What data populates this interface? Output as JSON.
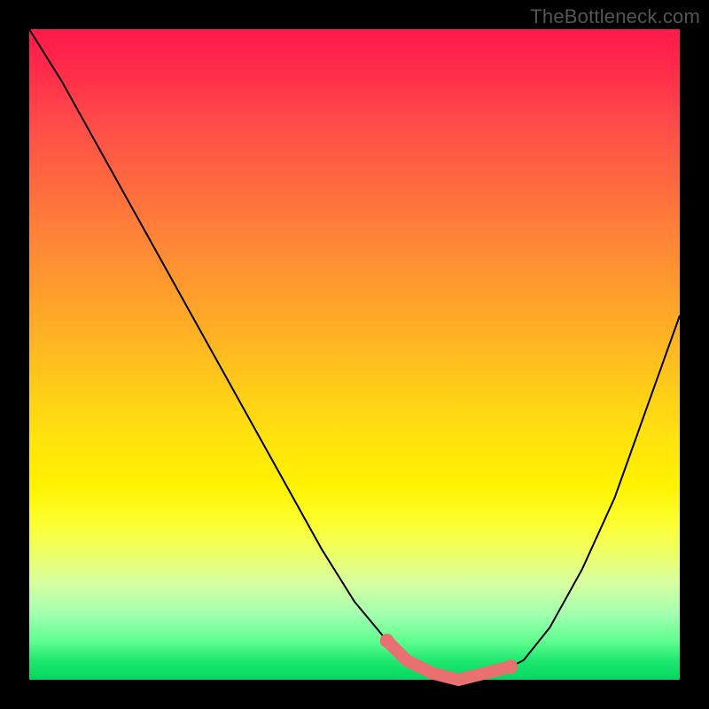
{
  "watermark": "TheBottleneck.com",
  "chart_data": {
    "type": "line",
    "title": "",
    "xlabel": "",
    "ylabel": "",
    "xlim": [
      0,
      100
    ],
    "ylim": [
      0,
      100
    ],
    "grid": false,
    "legend": false,
    "background_gradient": {
      "direction": "vertical",
      "stops": [
        {
          "pos": 0,
          "color": "#ff1a4a",
          "meaning": "high"
        },
        {
          "pos": 50,
          "color": "#ffd000",
          "meaning": "mid"
        },
        {
          "pos": 100,
          "color": "#00d860",
          "meaning": "low"
        }
      ]
    },
    "series": [
      {
        "name": "curve",
        "x": [
          0,
          5,
          10,
          15,
          20,
          25,
          30,
          35,
          40,
          45,
          50,
          55,
          60,
          62,
          65,
          68,
          72,
          76,
          80,
          85,
          90,
          95,
          100
        ],
        "y": [
          100,
          92,
          83,
          74,
          65,
          56,
          47,
          38,
          29,
          20,
          12,
          6,
          2,
          1,
          0,
          0,
          1,
          3,
          8,
          17,
          28,
          42,
          56
        ]
      }
    ],
    "highlight": {
      "name": "optimal-zone",
      "color": "#e87070",
      "x": [
        55,
        58,
        62,
        66,
        70,
        74
      ],
      "y": [
        6,
        3,
        1,
        0,
        1,
        2
      ]
    }
  }
}
